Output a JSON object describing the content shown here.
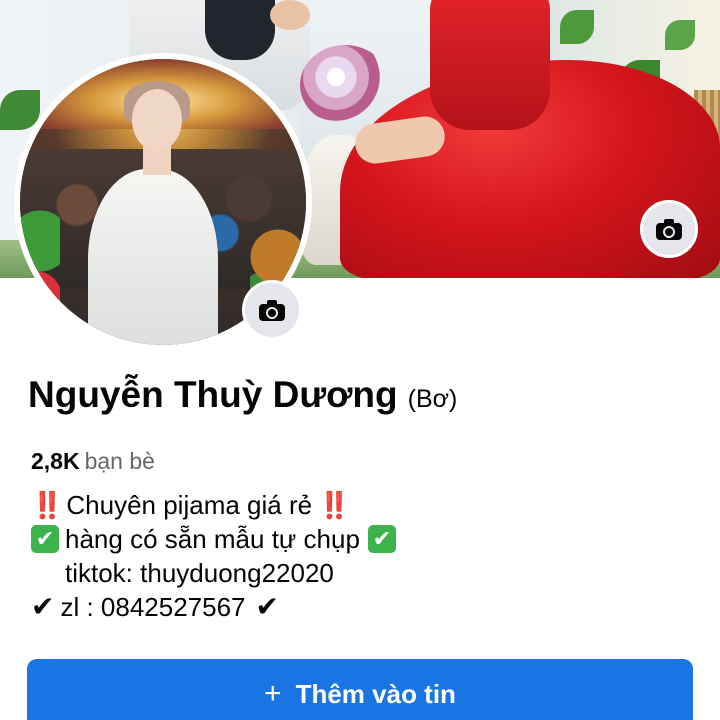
{
  "profile": {
    "name": "Nguyễn Thuỳ Dương",
    "alt_name": "(Bơ)",
    "friends_count": "2,8K",
    "friends_label": "bạn bè"
  },
  "bio": {
    "line1": "Chuyên pijama giá rẻ",
    "line2": "hàng có sẵn mẫu tự chụp",
    "line3": "tiktok: thuyduong22020",
    "line4": "zl : 0842527567",
    "emoji_bang": "‼️",
    "emoji_check_box": "✔",
    "emoji_check": "✔"
  },
  "actions": {
    "add_story_icon": "+",
    "add_story_label": "Thêm vào tin"
  },
  "icons": {
    "cover_camera": "camera-icon",
    "avatar_camera": "camera-icon",
    "add": "plus-icon"
  },
  "colors": {
    "primary_button": "#1b74e4",
    "secondary_text": "#65676b",
    "camera_button_bg": "#e4e6eb"
  }
}
